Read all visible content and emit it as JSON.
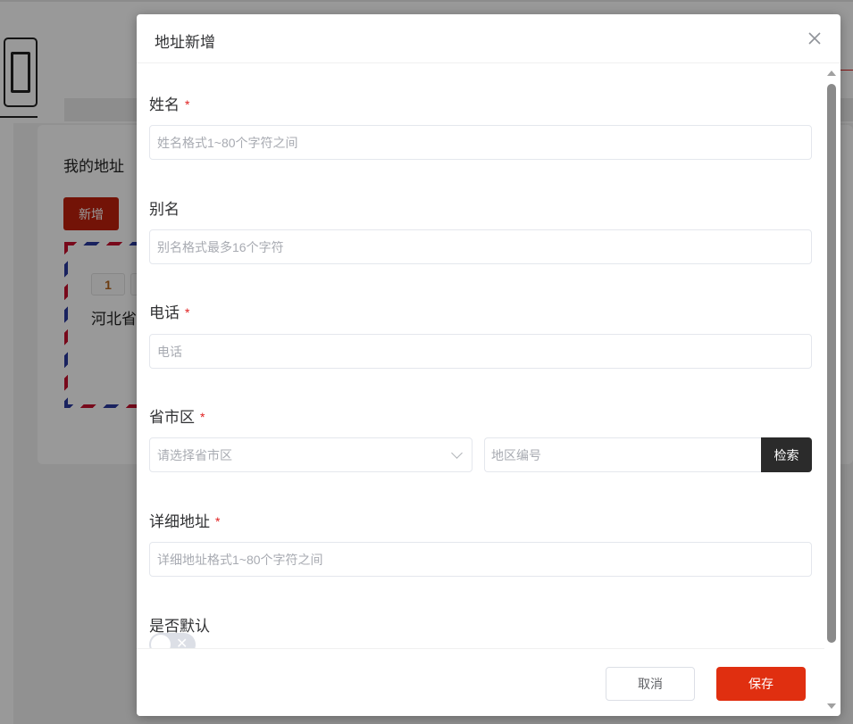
{
  "background": {
    "section_title": "我的地址",
    "add_button": "新增",
    "address_card": {
      "tag": "1",
      "address_text": "河北省"
    },
    "logo_dot": "。"
  },
  "dialog": {
    "title": "地址新增",
    "close_icon": "close-icon",
    "fields": {
      "name": {
        "label": "姓名",
        "required_mark": "*",
        "placeholder": "姓名格式1~80个字符之间"
      },
      "alias": {
        "label": "别名",
        "placeholder": "别名格式最多16个字符"
      },
      "phone": {
        "label": "电话",
        "required_mark": "*",
        "placeholder": "电话"
      },
      "region": {
        "label": "省市区",
        "required_mark": "*",
        "select_placeholder": "请选择省市区",
        "code_placeholder": "地区编号",
        "search_button": "检索"
      },
      "detail": {
        "label": "详细地址",
        "required_mark": "*",
        "placeholder": "详细地址格式1~80个字符之间"
      },
      "default": {
        "label": "是否默认",
        "switch_on": false,
        "switch_off_glyph": "✕"
      }
    },
    "footer": {
      "cancel": "取消",
      "save": "保存"
    }
  },
  "colors": {
    "primary": "#e02f10",
    "required": "#e02020",
    "search_button_bg": "#2b2b2b"
  }
}
